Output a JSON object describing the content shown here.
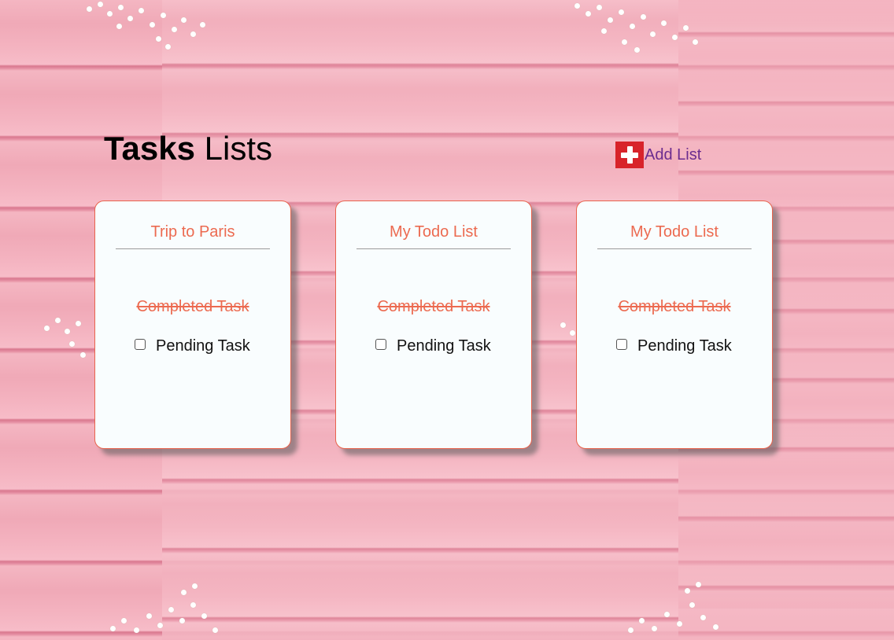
{
  "header": {
    "title_bold": "Tasks",
    "title_rest": " Lists",
    "add_button_label": "Add List",
    "add_icon": "plus-icon"
  },
  "lists": [
    {
      "title": "Trip to Paris",
      "completed_task": "Completed Task",
      "pending_task": "Pending Task",
      "pending_checked": false
    },
    {
      "title": "My Todo List",
      "completed_task": "Completed Task",
      "pending_task": "Pending Task",
      "pending_checked": false
    },
    {
      "title": "My Todo List",
      "completed_task": "Completed Task",
      "pending_task": "Pending Task",
      "pending_checked": false
    }
  ],
  "colors": {
    "accent": "#ec6a50",
    "card_border": "#e8634d",
    "add_icon_bg": "#d8232a",
    "add_link": "#6b2c8f",
    "background": "#f1a6b4"
  }
}
